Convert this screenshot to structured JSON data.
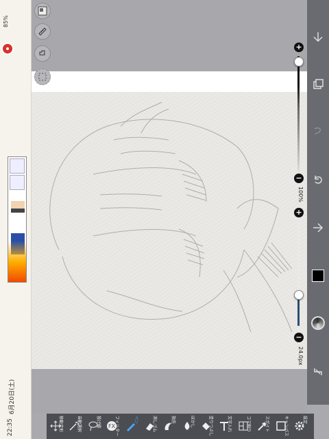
{
  "status": {
    "time": "22:35",
    "date": "6月20日(土)",
    "battery": "85%"
  },
  "canvas": {
    "paper_color": "#ebeae6",
    "background_color": "#a7a7ac"
  },
  "sliders": {
    "opacity_label": "100%",
    "size_label": "24.0px",
    "minus": "−",
    "plus": "+"
  },
  "colors": {
    "current": "#000000",
    "accent": "#2b4e72"
  },
  "toolbar": {
    "tools": [
      {
        "label": "移動変形",
        "icon": "move-icon"
      },
      {
        "label": "自動選択",
        "icon": "magic-wand-icon"
      },
      {
        "label": "投げ縄",
        "icon": "lasso-icon"
      },
      {
        "label": "フィルター",
        "icon": "fx-icon"
      },
      {
        "label": "ペン",
        "icon": "pen-icon"
      },
      {
        "label": "消しゴム",
        "icon": "eraser-icon"
      },
      {
        "label": "指先",
        "icon": "finger-icon"
      },
      {
        "label": "ぼかし",
        "icon": "blur-icon"
      },
      {
        "label": "塗りつぶし",
        "icon": "bucket-icon"
      },
      {
        "label": "文字入れ",
        "icon": "text-icon"
      },
      {
        "label": "コマ割り",
        "icon": "frame-icon"
      },
      {
        "label": "スポイト",
        "icon": "eyedropper-icon"
      },
      {
        "label": "キャンバス",
        "icon": "canvas-icon"
      },
      {
        "label": "設定",
        "icon": "gear-icon"
      }
    ],
    "active_index": 4
  }
}
